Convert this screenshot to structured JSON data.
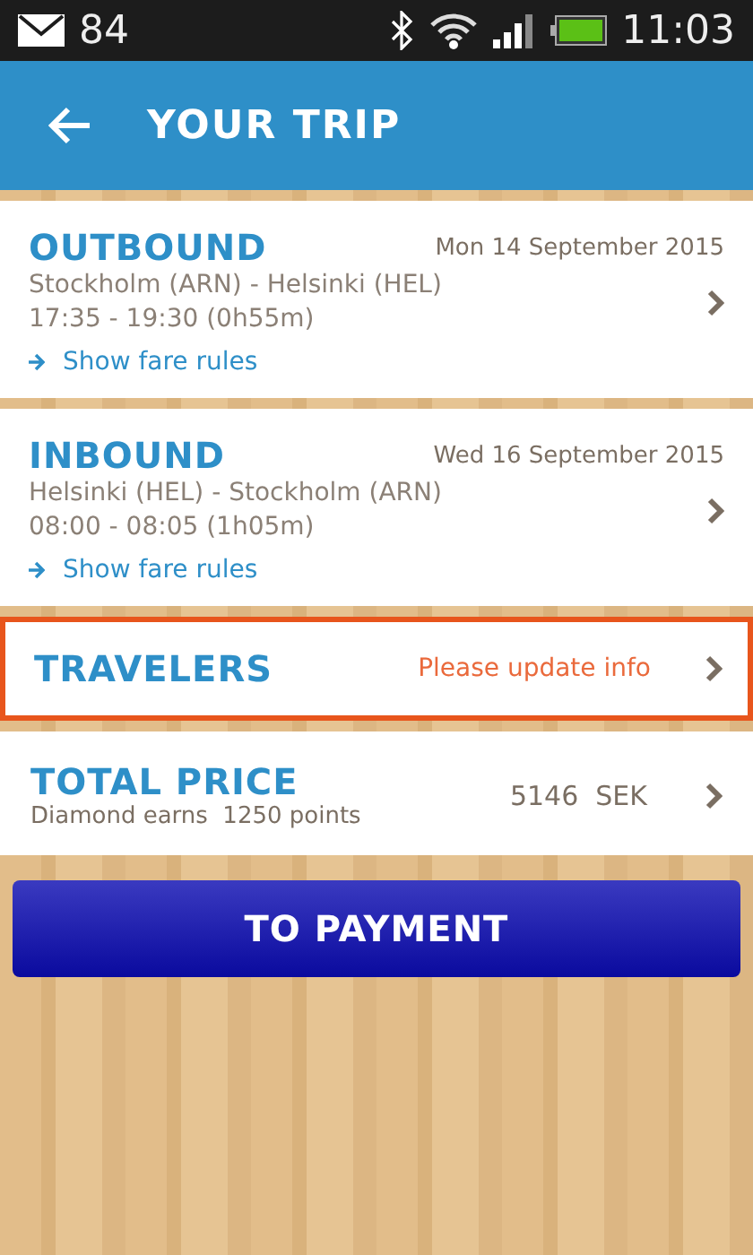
{
  "status_bar": {
    "mail_count": "84",
    "time": "11:03"
  },
  "header": {
    "title": "YOUR TRIP"
  },
  "flights": [
    {
      "title": "OUTBOUND",
      "date": "Mon 14 September 2015",
      "route": "Stockholm (ARN) - Helsinki (HEL)",
      "times": "17:35 - 19:30 (0h55m)",
      "link": "Show fare rules"
    },
    {
      "title": "INBOUND",
      "date": "Wed 16 September 2015",
      "route": "Helsinki (HEL) - Stockholm (ARN)",
      "times": "08:00 - 08:05 (1h05m)",
      "link": "Show fare rules"
    }
  ],
  "travelers": {
    "title": "TRAVELERS",
    "notice": "Please update info",
    "highlighted": true
  },
  "total": {
    "title": "TOTAL PRICE",
    "points": "Diamond earns  1250 points",
    "price": "5146  SEK"
  },
  "button": "TO PAYMENT"
}
